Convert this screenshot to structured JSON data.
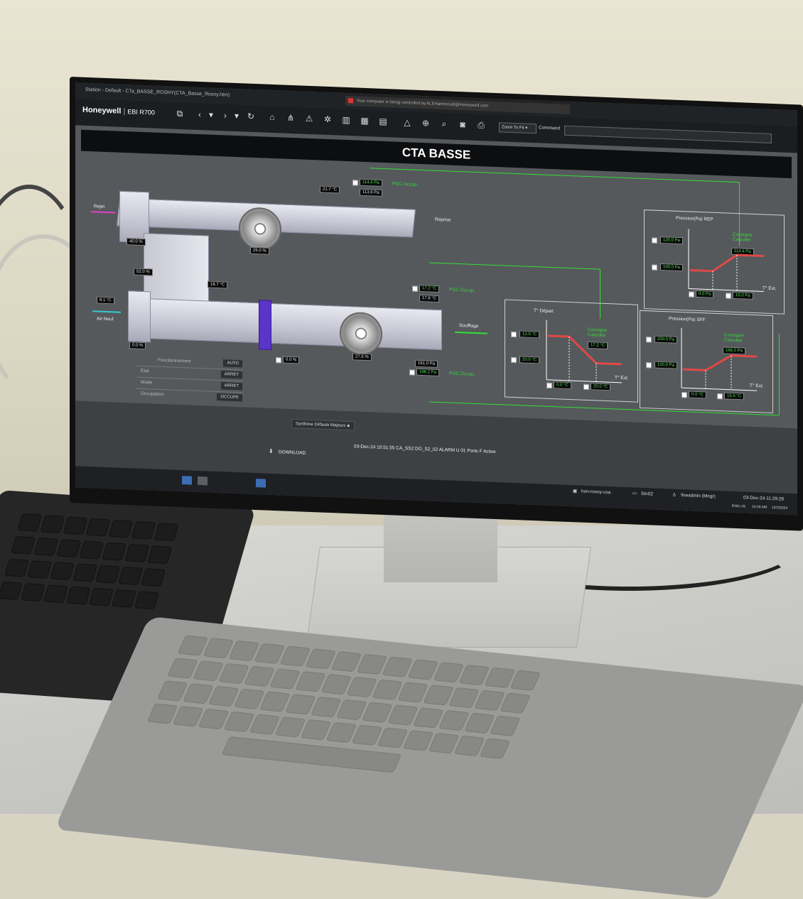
{
  "window": {
    "title": "Station - Default - CTa_BASSE_ROSNY(CTA_Basse_Rosny.htm)",
    "remote_notice": "Your computer is being controlled by ALEHammoudi@Honeywell.com"
  },
  "toolbar": {
    "brand": "Honeywell",
    "product": "EBI R700",
    "zoom_label": "Zoom To Fit",
    "command_label": "Command"
  },
  "display": {
    "title": "CTA BASSE"
  },
  "ahu": {
    "rejet_label": "Rejet",
    "reprise_label": "Reprise",
    "soufflage_label": "Soufflage",
    "air_neuf_label": "Air Neuf",
    "extract_temp": "21.7 °C",
    "extract_pressure_sp": "114.4 Pa",
    "extract_pressure": "113.6 Pa",
    "pgc_occup_1": "PGC Occup.",
    "damper_exhaust": "40.0 %",
    "fan_return_speed": "25.0 %",
    "damper_mix": "52.0 %",
    "mix_temp": "18.7 °C",
    "outdoor_temp": "8.1 °C",
    "damper_fresh": "0.0 %",
    "valve_pct": "0.0 %",
    "fan_supply_speed": "27.5 %",
    "supply_temp_sp": "17.2 °C",
    "supply_temp": "17.6 °C",
    "pgc_occup_2": "PGC Occup.",
    "supply_pressure": "161.0 Pa",
    "supply_pressure_sp": "166.2 Pa",
    "pgc_occup_3": "PGC Occup."
  },
  "status_table": [
    {
      "label": "Fonctionnement",
      "value": "AUTO"
    },
    {
      "label": "Etat",
      "value": "ARRET"
    },
    {
      "label": "Mode",
      "value": "ARRET"
    },
    {
      "label": "Occupation",
      "value": "OCCUPE"
    }
  ],
  "chart_rep": {
    "title": "Pression(Pa) REP",
    "consigne_label": "Consigne Calculée",
    "consigne_value": "114.4 Pa",
    "high_value": "125.0 Pa",
    "low_value": "100.0 Pa",
    "x1": "0.0 Pa",
    "x2": "15.0 Pa",
    "xaxis": "T° Ext."
  },
  "chart_depart": {
    "title": "T° Départ",
    "consigne_label": "Consigne Calculée",
    "consigne_value": "17.2 °C",
    "high_value": "12.0 °C",
    "low_value": "20.0 °C",
    "x1": "0.0 °C",
    "x2": "20.0 °C",
    "xaxis": "T° Ext."
  },
  "chart_sff": {
    "title": "Pression(Pa) SFF",
    "consigne_label": "Consigne Calculée",
    "consigne_value": "166.2 Pa",
    "high_value": "200.0 Pa",
    "low_value": "120.0 Pa",
    "x1": "0.0 °C",
    "x2": "15.0 °C",
    "xaxis": "T° Ext."
  },
  "footer": {
    "synthese_button": "Synthèse Défauts Majeurs",
    "download_label": "DOWNLOAD",
    "alarm_line": "03-Dec-24  10:51:55  CA_SS2  DO_S2_02  ALARM  U 01 Porte F  Active",
    "server": "hon-rosny-csa",
    "station": "Stn02",
    "user": "\\hwadmin (Mngr)",
    "datetime": "03-Dec-24  11:29:28",
    "lang": "ENG US",
    "clock_time": "10:29 AM",
    "clock_date": "12/3/2024"
  }
}
